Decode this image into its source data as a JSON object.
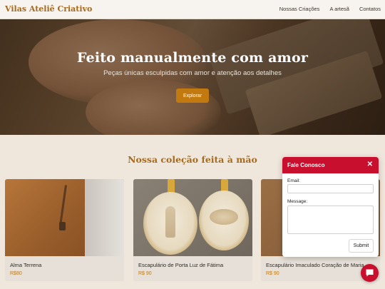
{
  "header": {
    "brand": "Vilas Ateliê Criativo",
    "nav": [
      "Nossas Criações",
      "A artesã",
      "Contatos"
    ]
  },
  "hero": {
    "title": "Feito manualmente com amor",
    "subtitle": "Peças únicas esculpidas com amor e atenção aos detalhes",
    "button_label": "Explorar"
  },
  "collection": {
    "title": "Nossa coleção feita à mão",
    "products": [
      {
        "name": "Alma Terrena",
        "price": "R$80"
      },
      {
        "name": "Escapulário de Porta Luz de Fátima",
        "price": "R$ 90"
      },
      {
        "name": "Escapulário Imaculado Coração de Maria",
        "price": "R$ 90"
      }
    ]
  },
  "contact": {
    "title": "Fale Conosco",
    "close_icon": "close-icon",
    "email_label": "Email:",
    "message_label": "Message:",
    "submit_label": "Submit"
  },
  "chat": {
    "icon": "chat-bubble-icon"
  },
  "colors": {
    "accent": "#c2790f",
    "brand_text": "#a66a1f",
    "contact_header": "#c8102e",
    "page_bg": "#efe7dc"
  }
}
